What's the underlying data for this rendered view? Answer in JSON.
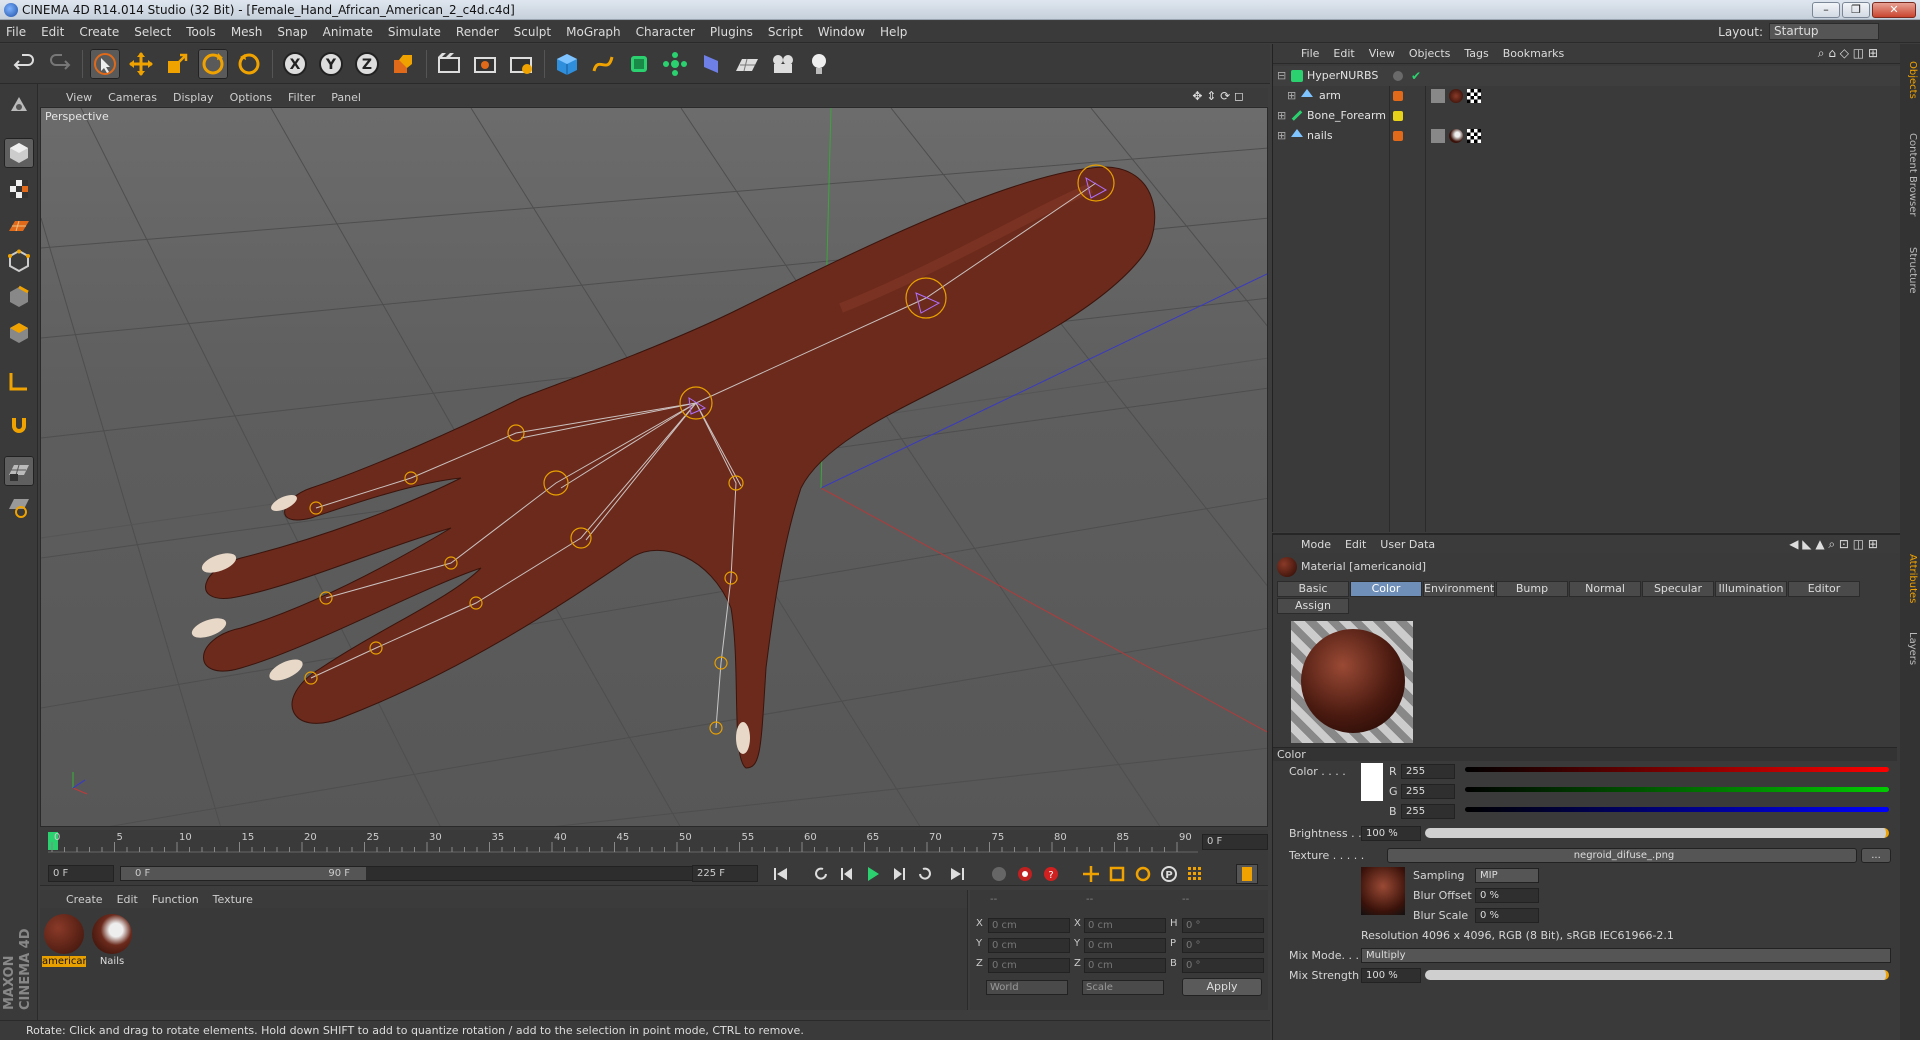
{
  "window": {
    "title": "CINEMA 4D R14.014 Studio (32 Bit) - [Female_Hand_African_American_2_c4d.c4d]"
  },
  "menubar": {
    "items": [
      "File",
      "Edit",
      "Create",
      "Select",
      "Tools",
      "Mesh",
      "Snap",
      "Animate",
      "Simulate",
      "Render",
      "Sculpt",
      "MoGraph",
      "Character",
      "Plugins",
      "Script",
      "Window",
      "Help"
    ],
    "layout_label": "Layout:",
    "layout_value": "Startup"
  },
  "viewport": {
    "menu": [
      "View",
      "Cameras",
      "Display",
      "Options",
      "Filter",
      "Panel"
    ],
    "label": "Perspective"
  },
  "timeline": {
    "ticks": [
      "0",
      "5",
      "10",
      "15",
      "20",
      "25",
      "30",
      "35",
      "40",
      "45",
      "50",
      "55",
      "60",
      "65",
      "70",
      "75",
      "80",
      "85",
      "90"
    ],
    "current_frame": "0 F"
  },
  "playbar": {
    "start_field": "0 F",
    "range_start": "0 F",
    "range_end": "90 F",
    "end_field": "225 F"
  },
  "material_manager": {
    "menu": [
      "Create",
      "Edit",
      "Function",
      "Texture"
    ],
    "materials": [
      {
        "name": "american",
        "selected": true
      },
      {
        "name": "Nails",
        "selected": false
      }
    ]
  },
  "coordinates": {
    "header_a": "--",
    "header_b": "--",
    "header_c": "--",
    "rows": [
      {
        "a_lbl": "X",
        "a_val": "0 cm",
        "b_lbl": "X",
        "b_val": "0 cm",
        "c_lbl": "H",
        "c_val": "0 °"
      },
      {
        "a_lbl": "Y",
        "a_val": "0 cm",
        "b_lbl": "Y",
        "b_val": "0 cm",
        "c_lbl": "P",
        "c_val": "0 °"
      },
      {
        "a_lbl": "Z",
        "a_val": "0 cm",
        "b_lbl": "Z",
        "b_val": "0 cm",
        "c_lbl": "B",
        "c_val": "0 °"
      }
    ],
    "space": "World",
    "mode": "Scale",
    "apply_label": "Apply"
  },
  "status": {
    "text": "Rotate: Click and drag to rotate elements. Hold down SHIFT to add to quantize rotation / add to the selection in point mode, CTRL to remove."
  },
  "object_manager": {
    "menu": [
      "File",
      "Edit",
      "View",
      "Objects",
      "Tags",
      "Bookmarks"
    ],
    "objects": [
      {
        "name": "HyperNURBS",
        "color": "#6a6a6a"
      },
      {
        "name": "arm",
        "color": "#e06a1a"
      },
      {
        "name": "Bone_Forearm",
        "color": "#e8d21a"
      },
      {
        "name": "nails",
        "color": "#e06a1a"
      }
    ]
  },
  "attribute_manager": {
    "menu": [
      "Mode",
      "Edit",
      "User Data"
    ],
    "material_title": "Material [americanoid]",
    "tabs": [
      "Basic",
      "Color",
      "Environment",
      "Bump",
      "Normal",
      "Specular",
      "Illumination",
      "Editor",
      "Assign"
    ],
    "active_tab": "Color",
    "section": "Color",
    "color_label": "Color . . . .",
    "r_label": "R",
    "r_value": "255",
    "g_label": "G",
    "g_value": "255",
    "b_label": "B",
    "b_value": "255",
    "brightness_label": "Brightness . .",
    "brightness_value": "100 %",
    "texture_label": "Texture . . . . .",
    "texture_file": "negroid_difuse_.png",
    "texture_more": "...",
    "sampling_label": "Sampling",
    "sampling_value": "MIP",
    "blur_offset_label": "Blur Offset",
    "blur_offset_value": "0 %",
    "blur_scale_label": "Blur Scale",
    "blur_scale_value": "0 %",
    "resolution": "Resolution 4096 x 4096, RGB (8 Bit), sRGB IEC61966-2.1",
    "mix_mode_label": "Mix Mode. . .",
    "mix_mode_value": "Multiply",
    "mix_strength_label": "Mix Strength",
    "mix_strength_value": "100 %"
  },
  "side_tabs": [
    "Objects",
    "Content Browser",
    "Structure",
    "Attributes",
    "Layers"
  ],
  "colors": {
    "accent": "#f0a300",
    "active_tab": "#6f8fb8",
    "skin": "#6b2a1c"
  }
}
